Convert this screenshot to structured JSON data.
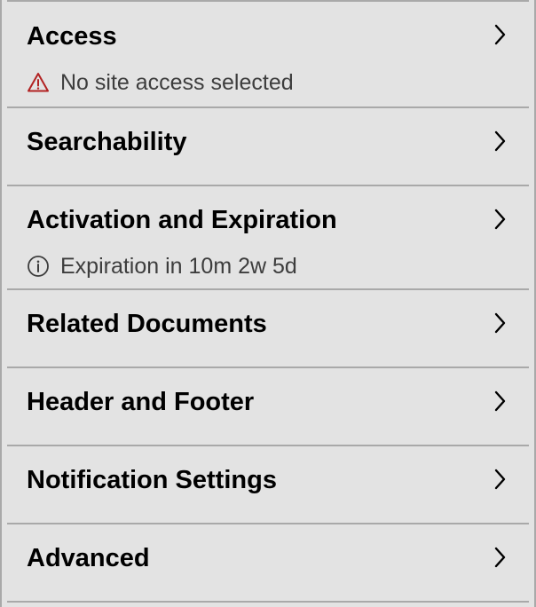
{
  "sections": [
    {
      "title": "Access",
      "status": {
        "type": "warning",
        "icon": "warning-triangle-icon",
        "text": "No site access selected",
        "color": "#b22222"
      }
    },
    {
      "title": "Searchability"
    },
    {
      "title": "Activation and Expiration",
      "status": {
        "type": "info",
        "icon": "info-circle-icon",
        "text": "Expiration in 10m 2w 5d",
        "color": "#3d3d3d"
      }
    },
    {
      "title": "Related Documents"
    },
    {
      "title": "Header and Footer"
    },
    {
      "title": "Notification Settings"
    },
    {
      "title": "Advanced"
    }
  ],
  "icons": {
    "row_action": "chevron-right-icon"
  },
  "colors": {
    "background": "#e3e3e3",
    "divider": "#a9a9a9",
    "warning": "#b22222",
    "secondary_text": "#3d3d3d"
  }
}
